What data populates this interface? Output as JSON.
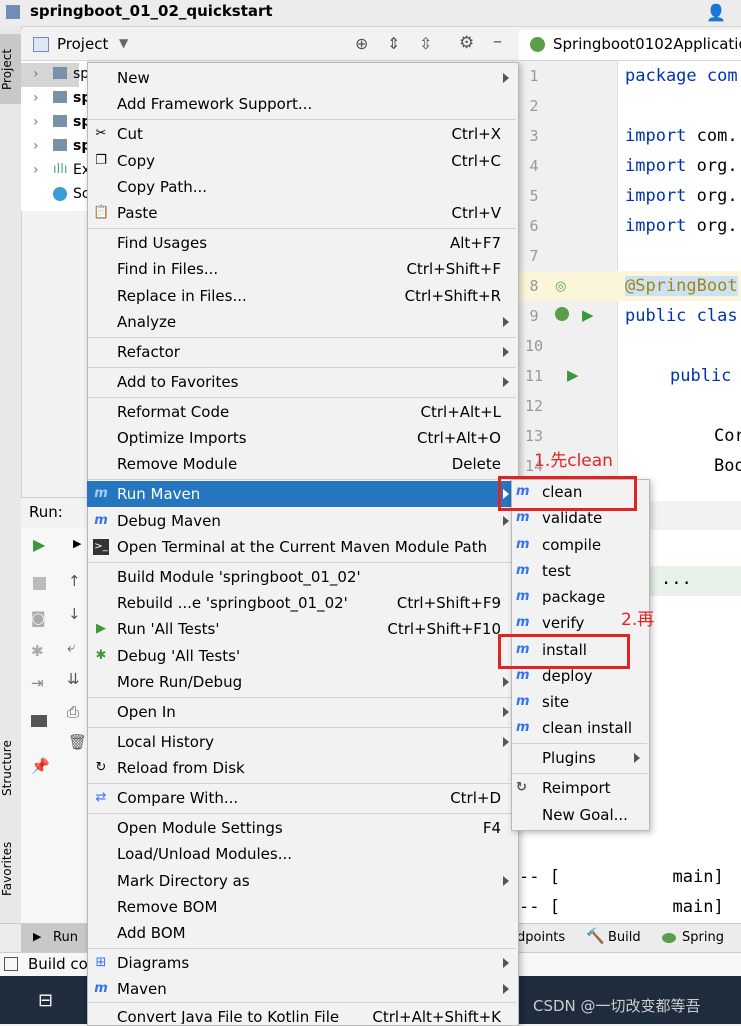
{
  "window": {
    "title": "springboot_01_02_quickstart"
  },
  "left_strip": {
    "project": "Project",
    "structure": "Structure",
    "favorites": "Favorites"
  },
  "project_panel": {
    "title": "Project",
    "tree": [
      "sp",
      "sp",
      "sp",
      "sp",
      "Ex",
      "Sc"
    ]
  },
  "editor": {
    "tab": "Springboot0102Applicatio",
    "lines": [
      {
        "n": "1",
        "code": "package com"
      },
      {
        "n": "2",
        "code": ""
      },
      {
        "n": "3",
        "code": "import com."
      },
      {
        "n": "4",
        "code": "import org."
      },
      {
        "n": "5",
        "code": "import org."
      },
      {
        "n": "6",
        "code": "import org."
      },
      {
        "n": "7",
        "code": ""
      },
      {
        "n": "8",
        "code": "@SpringBoot"
      },
      {
        "n": "9",
        "code": "public clas"
      },
      {
        "n": "10",
        "code": ""
      },
      {
        "n": "11",
        "code": "public"
      },
      {
        "n": "12",
        "code": ""
      },
      {
        "n": "13",
        "code": "Cor"
      },
      {
        "n": "14",
        "code": "Boo"
      }
    ]
  },
  "run_panel": {
    "label": "Run:"
  },
  "console": {
    "ellipsis": "...",
    "line1": "-- [           main]",
    "line2": "-- [           main]"
  },
  "bottom_tabs": {
    "run": "Run",
    "endpoints": "dpoints",
    "build": "Build",
    "spring": "Spring"
  },
  "build_bar": {
    "text": "Build co"
  },
  "context_menu": {
    "items": [
      {
        "label": "New",
        "shortcut": "",
        "submenu": true
      },
      {
        "label": "Add Framework Support...",
        "shortcut": "",
        "submenu": false
      },
      {
        "label": "Cut",
        "shortcut": "Ctrl+X",
        "submenu": false
      },
      {
        "label": "Copy",
        "shortcut": "Ctrl+C",
        "submenu": false
      },
      {
        "label": "Copy Path...",
        "shortcut": "",
        "submenu": false
      },
      {
        "label": "Paste",
        "shortcut": "Ctrl+V",
        "submenu": false
      },
      {
        "label": "Find Usages",
        "shortcut": "Alt+F7",
        "submenu": false
      },
      {
        "label": "Find in Files...",
        "shortcut": "Ctrl+Shift+F",
        "submenu": false
      },
      {
        "label": "Replace in Files...",
        "shortcut": "Ctrl+Shift+R",
        "submenu": false
      },
      {
        "label": "Analyze",
        "shortcut": "",
        "submenu": true
      },
      {
        "label": "Refactor",
        "shortcut": "",
        "submenu": true
      },
      {
        "label": "Add to Favorites",
        "shortcut": "",
        "submenu": true
      },
      {
        "label": "Reformat Code",
        "shortcut": "Ctrl+Alt+L",
        "submenu": false
      },
      {
        "label": "Optimize Imports",
        "shortcut": "Ctrl+Alt+O",
        "submenu": false
      },
      {
        "label": "Remove Module",
        "shortcut": "Delete",
        "submenu": false
      },
      {
        "label": "Run Maven",
        "shortcut": "",
        "submenu": true
      },
      {
        "label": "Debug Maven",
        "shortcut": "",
        "submenu": true
      },
      {
        "label": "Open Terminal at the Current Maven Module Path",
        "shortcut": "",
        "submenu": false
      },
      {
        "label": "Build Module 'springboot_01_02'",
        "shortcut": "",
        "submenu": false
      },
      {
        "label": "Rebuild ...e 'springboot_01_02'",
        "shortcut": "Ctrl+Shift+F9",
        "submenu": false
      },
      {
        "label": "Run 'All Tests'",
        "shortcut": "Ctrl+Shift+F10",
        "submenu": false
      },
      {
        "label": "Debug 'All Tests'",
        "shortcut": "",
        "submenu": false
      },
      {
        "label": "More Run/Debug",
        "shortcut": "",
        "submenu": true
      },
      {
        "label": "Open In",
        "shortcut": "",
        "submenu": true
      },
      {
        "label": "Local History",
        "shortcut": "",
        "submenu": true
      },
      {
        "label": "Reload from Disk",
        "shortcut": "",
        "submenu": false
      },
      {
        "label": "Compare With...",
        "shortcut": "Ctrl+D",
        "submenu": false
      },
      {
        "label": "Open Module Settings",
        "shortcut": "F4",
        "submenu": false
      },
      {
        "label": "Load/Unload Modules...",
        "shortcut": "",
        "submenu": false
      },
      {
        "label": "Mark Directory as",
        "shortcut": "",
        "submenu": true
      },
      {
        "label": "Remove BOM",
        "shortcut": "",
        "submenu": false
      },
      {
        "label": "Add BOM",
        "shortcut": "",
        "submenu": false
      },
      {
        "label": "Diagrams",
        "shortcut": "",
        "submenu": true
      },
      {
        "label": "Maven",
        "shortcut": "",
        "submenu": true
      },
      {
        "label": "Convert Java File to Kotlin File",
        "shortcut": "Ctrl+Alt+Shift+K",
        "submenu": false
      }
    ]
  },
  "maven_submenu": {
    "items": [
      "clean",
      "validate",
      "compile",
      "test",
      "package",
      "verify",
      "install",
      "deploy",
      "site",
      "clean install",
      "Plugins",
      "Reimport",
      "New Goal..."
    ]
  },
  "annotations": {
    "step1": "1.先clean",
    "step2": "2.再",
    "color": "#e02424"
  },
  "watermark": "CSDN @一切改变都等吾",
  "colors": {
    "selection": "#2675bf",
    "maven_icon": "#3574f0"
  }
}
